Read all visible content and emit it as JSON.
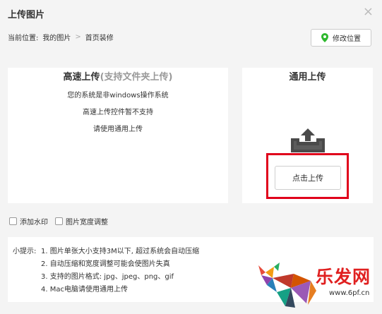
{
  "dialog": {
    "title": "上传图片",
    "close_glyph": "×"
  },
  "location": {
    "label": "当前位置:",
    "crumb1": "我的图片",
    "separator": ">",
    "crumb2": "首页装修",
    "edit_button": "修改位置"
  },
  "fast_upload": {
    "title": "高速上传",
    "subtitle": "(支持文件夹上传)",
    "line1": "您的系统是非windows操作系统",
    "line2": "高速上传控件暂不支持",
    "line3": "请使用通用上传"
  },
  "general_upload": {
    "title": "通用上传",
    "button": "点击上传"
  },
  "options": {
    "watermark": "添加水印",
    "width_adjust": "图片宽度调整"
  },
  "tips": {
    "prefix": "小提示:",
    "items": [
      "1. 图片单张大小支持3M以下, 超过系统会自动压缩",
      "2. 自动压缩和宽度调整可能会使图片失真",
      "3. 支持的图片格式: jpg、jpeg、png、gif",
      "4. Mac电脑请使用通用上传"
    ]
  },
  "watermark_logo": {
    "text": "乐发网",
    "url": "www.6pf.cn"
  },
  "colors": {
    "highlight": "#e0001b",
    "pin": "#2eb82e"
  }
}
